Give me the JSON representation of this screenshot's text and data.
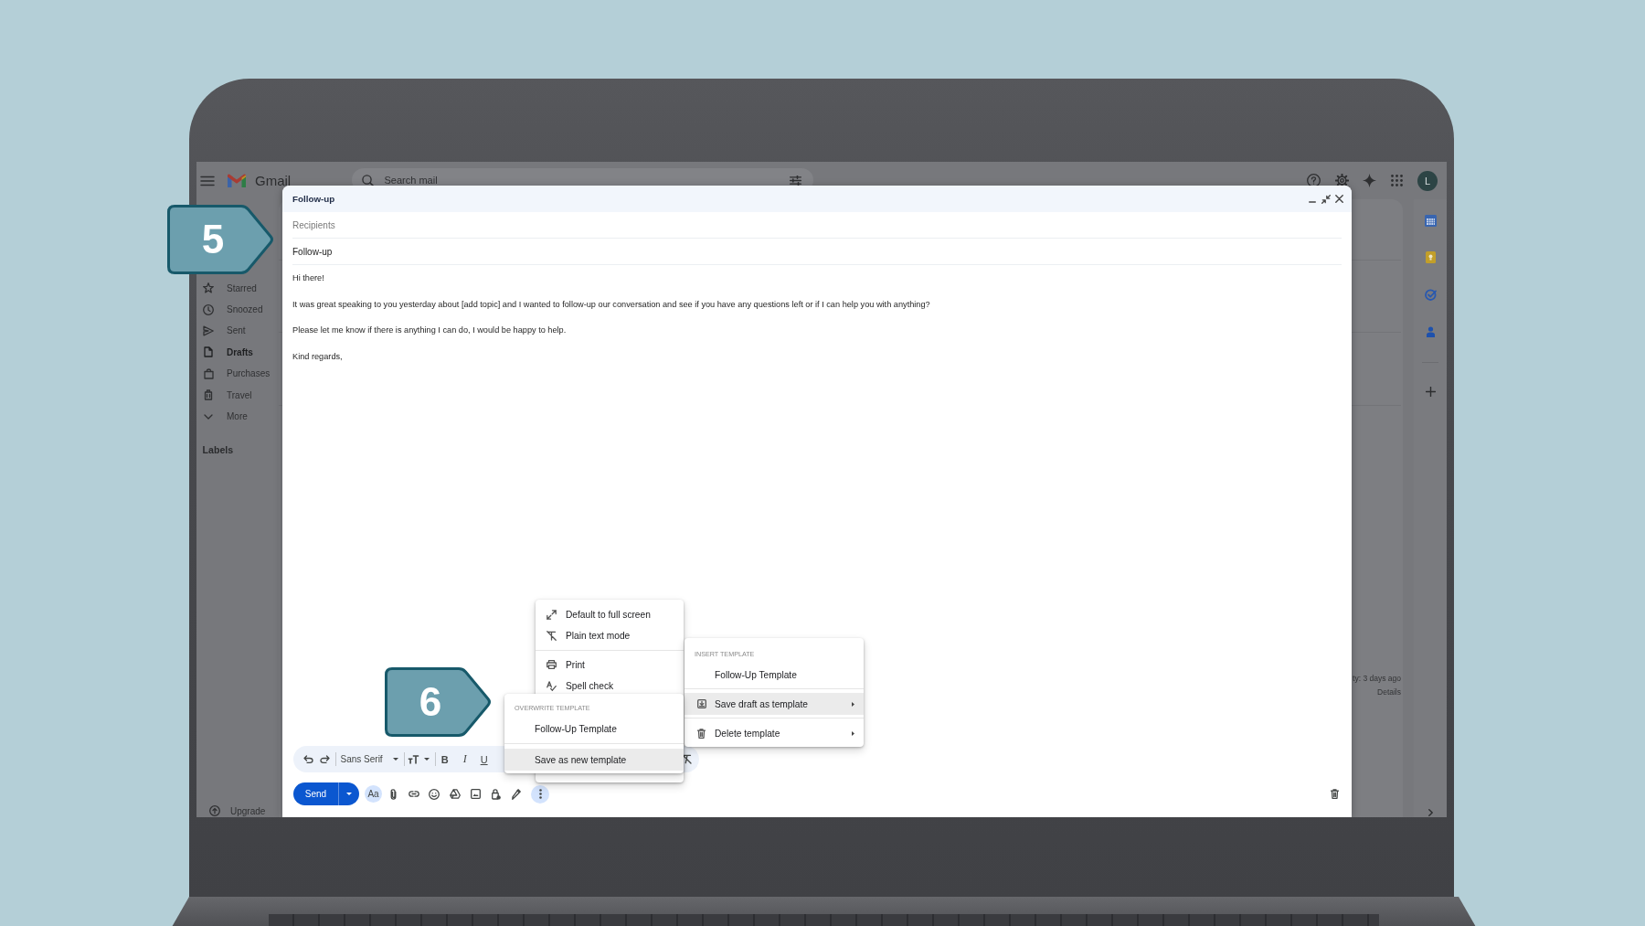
{
  "header": {
    "app_name": "Gmail",
    "search": {
      "placeholder": "Search mail"
    },
    "avatar": "L"
  },
  "sidebar": {
    "items": [
      {
        "label": "Starred",
        "unread": false
      },
      {
        "label": "Snoozed",
        "unread": false
      },
      {
        "label": "Sent",
        "unread": false
      },
      {
        "label": "Drafts",
        "unread": true
      },
      {
        "label": "Purchases",
        "unread": false
      },
      {
        "label": "Travel",
        "unread": false
      },
      {
        "label": "More",
        "unread": false
      }
    ],
    "labels_heading": "Labels",
    "upgrade": "Upgrade"
  },
  "mail_view": {
    "activity": "ty: 3 days ago",
    "details": "Details"
  },
  "compose": {
    "title": "Follow-up",
    "recipients": {
      "placeholder": "Recipients"
    },
    "subject": "Follow-up",
    "body": [
      "Hi there!",
      "It was great speaking to you yesterday about [add topic] and I wanted to follow-up our conversation and see if you have any questions left or if I can help you with anything?",
      "Please let me know if there is anything I can do, I would be happy to help.",
      "Kind regards,"
    ],
    "toolbar": {
      "font": "Sans Serif",
      "format_buttons": [
        "B",
        "I",
        "U"
      ]
    },
    "send": "Send",
    "formatting": {
      "label": "Aa",
      "on": true
    },
    "more_options": {
      "open": true
    }
  },
  "more_menu": {
    "groups": [
      {
        "items": [
          {
            "label": "Default to full screen"
          },
          {
            "label": "Plain text mode"
          }
        ]
      },
      {
        "items": [
          {
            "label": "Print"
          },
          {
            "label": "Spell check"
          }
        ]
      }
    ]
  },
  "insert_template_menu": {
    "heading": "INSERT TEMPLATE",
    "groups": [
      {
        "items": [
          {
            "label": "Follow-Up Template",
            "kind": "template",
            "selected": false
          }
        ]
      },
      {
        "items": [
          {
            "label": "Save draft as template",
            "kind": "submenu",
            "selected": true
          }
        ]
      },
      {
        "items": [
          {
            "label": "Delete template",
            "kind": "submenu",
            "selected": false
          }
        ]
      }
    ]
  },
  "overwrite_template_menu": {
    "heading": "OVERWRITE TEMPLATE",
    "groups": [
      {
        "items": [
          {
            "label": "Follow-Up Template",
            "selected": false
          }
        ]
      },
      {
        "items": [
          {
            "label": "Save as new template",
            "selected": true
          }
        ]
      }
    ]
  },
  "callouts": [
    {
      "label": "5"
    },
    {
      "label": "6"
    }
  ]
}
